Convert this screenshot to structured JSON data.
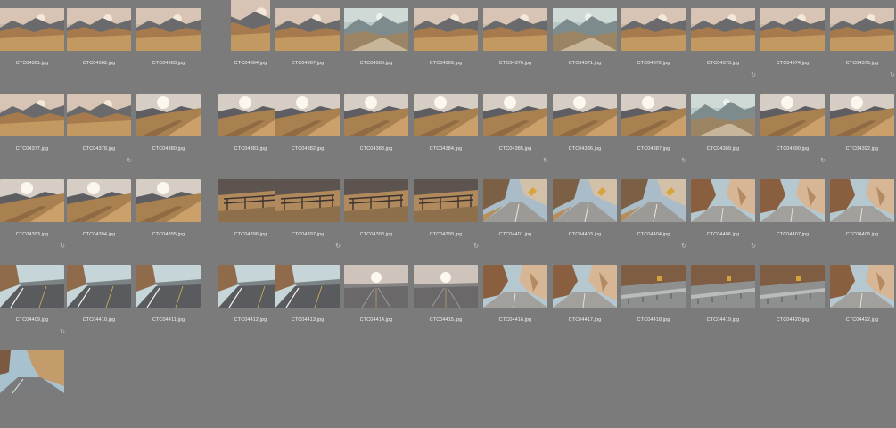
{
  "browser": {
    "rows": [
      [
        {
          "name": "CTC04361.jpg",
          "scene": "mtn-haze"
        },
        {
          "name": "CTC04362.jpg",
          "scene": "mtn-haze"
        },
        {
          "name": "CTC04363.jpg",
          "scene": "mtn-haze"
        },
        {
          "name": "CTC04364.jpg",
          "scene": "mtn-haze",
          "portrait": true
        },
        {
          "name": "CTC04367.jpg",
          "scene": "mtn-haze"
        },
        {
          "name": "CTC04368.jpg",
          "scene": "mtn-teal"
        },
        {
          "name": "CTC04369.jpg",
          "scene": "mtn-haze"
        },
        {
          "name": "CTC04370.jpg",
          "scene": "mtn-haze"
        },
        {
          "name": "CTC04371.jpg",
          "scene": "mtn-teal"
        },
        {
          "name": "CTC04372.jpg",
          "scene": "mtn-haze"
        },
        {
          "name": "CTC04373.jpg",
          "scene": "mtn-haze",
          "badge": true
        },
        {
          "name": "CTC04374.jpg",
          "scene": "mtn-haze"
        },
        {
          "name": "CTC04375.jpg",
          "scene": "mtn-haze",
          "badge": true
        }
      ],
      [
        {
          "name": "CTC04377.jpg",
          "scene": "mtn-haze"
        },
        {
          "name": "CTC04378.jpg",
          "scene": "mtn-haze",
          "badge": true
        },
        {
          "name": "CTC04380.jpg",
          "scene": "hill-sun"
        },
        {
          "name": "CTC04381.jpg",
          "scene": "hill-sun"
        },
        {
          "name": "CTC04382.jpg",
          "scene": "hill-sun"
        },
        {
          "name": "CTC04383.jpg",
          "scene": "hill-sun"
        },
        {
          "name": "CTC04384.jpg",
          "scene": "hill-sun"
        },
        {
          "name": "CTC04385.jpg",
          "scene": "hill-sun",
          "badge": true
        },
        {
          "name": "CTC04386.jpg",
          "scene": "hill-sun"
        },
        {
          "name": "CTC04387.jpg",
          "scene": "hill-sun",
          "badge": true
        },
        {
          "name": "CTC04389.jpg",
          "scene": "mtn-teal"
        },
        {
          "name": "CTC04390.jpg",
          "scene": "hill-sun",
          "badge": true
        },
        {
          "name": "CTC04392.jpg",
          "scene": "hill-sun"
        }
      ],
      [
        {
          "name": "CTC04393.jpg",
          "scene": "hill-sun",
          "badge": true
        },
        {
          "name": "CTC04394.jpg",
          "scene": "hill-sun"
        },
        {
          "name": "CTC04395.jpg",
          "scene": "hill-sun"
        },
        {
          "name": "CTC04396.jpg",
          "scene": "fence"
        },
        {
          "name": "CTC04397.jpg",
          "scene": "fence",
          "badge": true
        },
        {
          "name": "CTC04398.jpg",
          "scene": "fence"
        },
        {
          "name": "CTC04399.jpg",
          "scene": "fence",
          "badge": true
        },
        {
          "name": "CTC04401.jpg",
          "scene": "canyon-sign"
        },
        {
          "name": "CTC04403.jpg",
          "scene": "canyon-sign"
        },
        {
          "name": "CTC04404.jpg",
          "scene": "canyon-sign",
          "badge": true
        },
        {
          "name": "CTC04406.jpg",
          "scene": "canyon-rock",
          "badge": true
        },
        {
          "name": "CTC04407.jpg",
          "scene": "canyon-rock"
        },
        {
          "name": "CTC04408.jpg",
          "scene": "canyon-rock"
        }
      ],
      [
        {
          "name": "CTC04409.jpg",
          "scene": "road-rock",
          "badge": true
        },
        {
          "name": "CTC04410.jpg",
          "scene": "road-rock"
        },
        {
          "name": "CTC04411.jpg",
          "scene": "road-rock"
        },
        {
          "name": "CTC04412.jpg",
          "scene": "road-rock"
        },
        {
          "name": "CTC04413.jpg",
          "scene": "road-rock"
        },
        {
          "name": "CTC04414.jpg",
          "scene": "road-sun"
        },
        {
          "name": "CTC04415.jpg",
          "scene": "road-sun"
        },
        {
          "name": "CTC04416.jpg",
          "scene": "canyon-rock"
        },
        {
          "name": "CTC04417.jpg",
          "scene": "canyon-rock"
        },
        {
          "name": "CTC04418.jpg",
          "scene": "guardrail"
        },
        {
          "name": "CTC04419.jpg",
          "scene": "guardrail"
        },
        {
          "name": "CTC04420.jpg",
          "scene": "guardrail"
        },
        {
          "name": "CTC04422.jpg",
          "scene": "canyon-rock"
        }
      ],
      [
        {
          "name": "",
          "scene": "canyon-road"
        }
      ]
    ]
  },
  "palette": {
    "background": "#7b7b7b",
    "label": "#f2f2f2",
    "badge": "#c9c9c9"
  },
  "icons": {
    "badge": "rotate-edit-icon"
  }
}
